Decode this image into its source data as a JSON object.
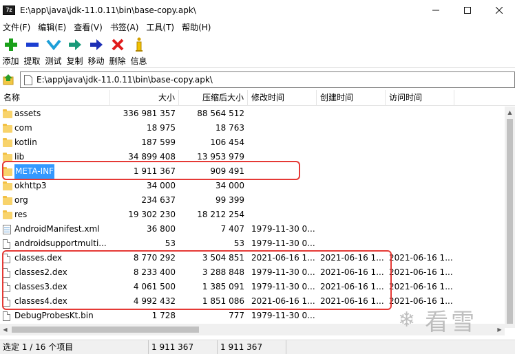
{
  "window": {
    "app_icon": "7z",
    "title": "E:\\app\\java\\jdk-11.0.11\\bin\\base-copy.apk\\",
    "minimize_icon": "minimize-icon",
    "maximize_icon": "maximize-icon",
    "close_icon": "close-icon"
  },
  "menu": [
    {
      "label": "文件(F)"
    },
    {
      "label": "编辑(E)"
    },
    {
      "label": "查看(V)"
    },
    {
      "label": "书签(A)"
    },
    {
      "label": "工具(T)"
    },
    {
      "label": "帮助(H)"
    }
  ],
  "toolbar": [
    {
      "label": "添加",
      "icon": "plus-icon",
      "color": "#1aa01a"
    },
    {
      "label": "提取",
      "icon": "minus-icon",
      "color": "#1c3fd1"
    },
    {
      "label": "测试",
      "icon": "check-icon",
      "color": "#1e9fd8"
    },
    {
      "label": "复制",
      "icon": "copy-arrow-icon",
      "color": "#1a9a7a"
    },
    {
      "label": "移动",
      "icon": "move-arrow-icon",
      "color": "#1c2fb5"
    },
    {
      "label": "删除",
      "icon": "delete-icon",
      "color": "#e01b1b"
    },
    {
      "label": "信息",
      "icon": "info-icon",
      "color": "#d4a000"
    }
  ],
  "address": {
    "path": "E:\\app\\java\\jdk-11.0.11\\bin\\base-copy.apk\\",
    "up_icon": "folder-up-icon"
  },
  "columns": {
    "name": "名称",
    "size": "大小",
    "packed": "压缩后大小",
    "modified": "修改时间",
    "created": "创建时间",
    "accessed": "访问时间"
  },
  "rows": [
    {
      "name": "assets",
      "type": "folder",
      "size": "336 981 357",
      "packed": "88 564 512",
      "modified": "",
      "created": "",
      "accessed": ""
    },
    {
      "name": "com",
      "type": "folder",
      "size": "18 975",
      "packed": "18 763",
      "modified": "",
      "created": "",
      "accessed": ""
    },
    {
      "name": "kotlin",
      "type": "folder",
      "size": "187 599",
      "packed": "106 454",
      "modified": "",
      "created": "",
      "accessed": ""
    },
    {
      "name": "lib",
      "type": "folder",
      "size": "34 899 408",
      "packed": "13 953 979",
      "modified": "",
      "created": "",
      "accessed": ""
    },
    {
      "name": "META-INF",
      "type": "folder",
      "size": "1 911 367",
      "packed": "909 491",
      "modified": "",
      "created": "",
      "accessed": "",
      "selected": true
    },
    {
      "name": "okhttp3",
      "type": "folder",
      "size": "34 000",
      "packed": "34 000",
      "modified": "",
      "created": "",
      "accessed": ""
    },
    {
      "name": "org",
      "type": "folder",
      "size": "234 637",
      "packed": "99 399",
      "modified": "",
      "created": "",
      "accessed": ""
    },
    {
      "name": "res",
      "type": "folder",
      "size": "19 302 230",
      "packed": "18 212 254",
      "modified": "",
      "created": "",
      "accessed": ""
    },
    {
      "name": "AndroidManifest.xml",
      "type": "xml",
      "size": "36 800",
      "packed": "7 407",
      "modified": "1979-11-30 0...",
      "created": "",
      "accessed": ""
    },
    {
      "name": "androidsupportmulti...",
      "type": "file",
      "size": "53",
      "packed": "53",
      "modified": "1979-11-30 0...",
      "created": "",
      "accessed": ""
    },
    {
      "name": "classes.dex",
      "type": "file",
      "size": "8 770 292",
      "packed": "3 504 851",
      "modified": "2021-06-16 1...",
      "created": "2021-06-16 1...",
      "accessed": "2021-06-16 1..."
    },
    {
      "name": "classes2.dex",
      "type": "file",
      "size": "8 233 400",
      "packed": "3 288 848",
      "modified": "1979-11-30 0...",
      "created": "2021-06-16 1...",
      "accessed": "2021-06-16 1..."
    },
    {
      "name": "classes3.dex",
      "type": "file",
      "size": "4 061 500",
      "packed": "1 385 091",
      "modified": "1979-11-30 0...",
      "created": "2021-06-16 1...",
      "accessed": "2021-06-16 1..."
    },
    {
      "name": "classes4.dex",
      "type": "file",
      "size": "4 992 432",
      "packed": "1 851 086",
      "modified": "2021-06-16 1...",
      "created": "2021-06-16 1...",
      "accessed": "2021-06-16 1..."
    },
    {
      "name": "DebugProbesKt.bin",
      "type": "file",
      "size": "1 728",
      "packed": "777",
      "modified": "1979-11-30 0...",
      "created": "",
      "accessed": ""
    }
  ],
  "status": {
    "selection": "选定 1 / 16 个项目",
    "size": "1 911 367",
    "packed": "1 911 367"
  },
  "watermark": {
    "icon": "snowflake-icon",
    "text": "看雪"
  },
  "colors": {
    "selection": "#3399ff",
    "highlight_box": "#e53935"
  }
}
